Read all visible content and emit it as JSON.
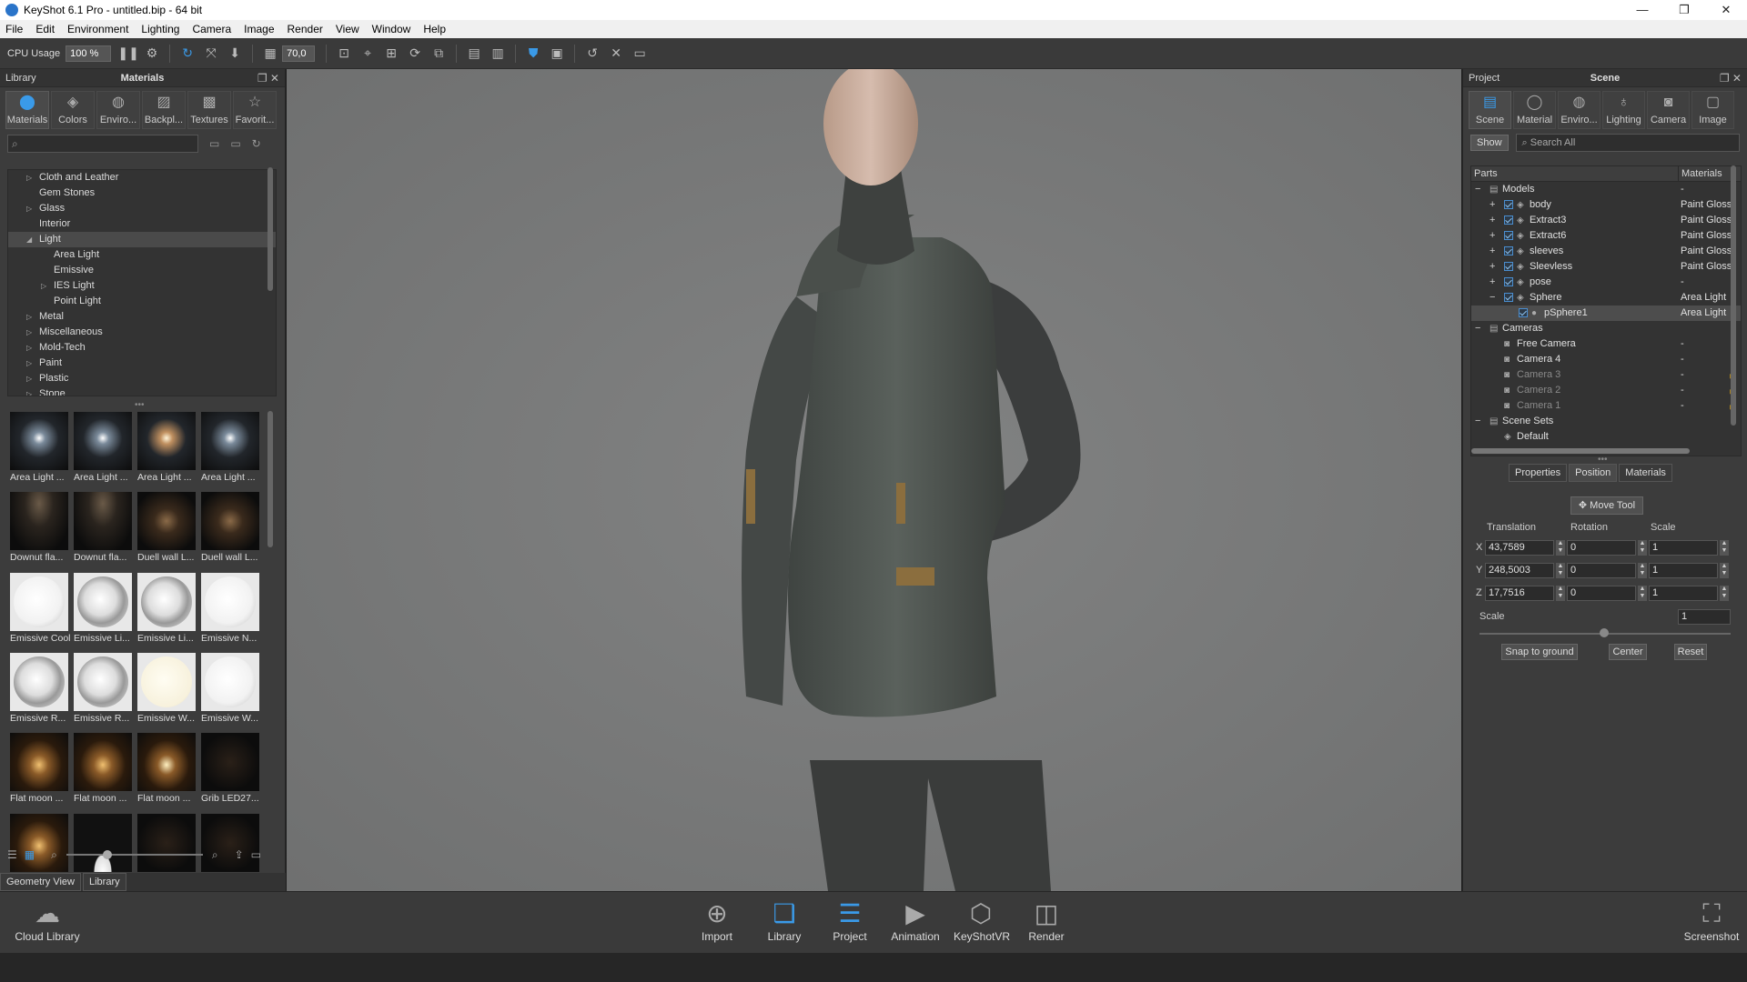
{
  "window": {
    "title": "KeyShot 6.1 Pro  - untitled.bip  - 64 bit",
    "controls": [
      "—",
      "❐",
      "✕"
    ]
  },
  "menu": [
    "File",
    "Edit",
    "Environment",
    "Lighting",
    "Camera",
    "Image",
    "Render",
    "View",
    "Window",
    "Help"
  ],
  "toolbar": {
    "cpu_label": "CPU Usage",
    "cpu_value": "100 %",
    "fov_value": "70,0"
  },
  "library": {
    "panel_left": "Library",
    "panel_title": "Materials",
    "tabs": [
      "Materials",
      "Colors",
      "Enviro...",
      "Backpl...",
      "Textures",
      "Favorit..."
    ],
    "tree": [
      {
        "label": "Cloth and Leather",
        "arrow": "▷",
        "level": 0
      },
      {
        "label": "Gem Stones",
        "arrow": "",
        "level": 0
      },
      {
        "label": "Glass",
        "arrow": "▷",
        "level": 0
      },
      {
        "label": "Interior",
        "arrow": "",
        "level": 0
      },
      {
        "label": "Light",
        "arrow": "◢",
        "level": 0
      },
      {
        "label": "Area Light",
        "arrow": "",
        "level": 1
      },
      {
        "label": "Emissive",
        "arrow": "",
        "level": 1
      },
      {
        "label": "IES Light",
        "arrow": "▷",
        "level": 1
      },
      {
        "label": "Point Light",
        "arrow": "",
        "level": 1
      },
      {
        "label": "Metal",
        "arrow": "▷",
        "level": 0
      },
      {
        "label": "Miscellaneous",
        "arrow": "▷",
        "level": 0
      },
      {
        "label": "Mold-Tech",
        "arrow": "▷",
        "level": 0
      },
      {
        "label": "Paint",
        "arrow": "▷",
        "level": 0
      },
      {
        "label": "Plastic",
        "arrow": "▷",
        "level": 0
      },
      {
        "label": "Stone",
        "arrow": "▷",
        "level": 0
      }
    ],
    "thumbnails": [
      "Area Light ...",
      "Area Light ...",
      "Area Light ...",
      "Area Light ...",
      "Downut fla...",
      "Downut fla...",
      "Duell wall L...",
      "Duell wall L...",
      "Emissive Cool",
      "Emissive Li...",
      "Emissive Li...",
      "Emissive N...",
      "Emissive R...",
      "Emissive R...",
      "Emissive W...",
      "Emissive W...",
      "Flat moon ...",
      "Flat moon ...",
      "Flat moon ...",
      "Grib LED27...",
      "",
      "",
      "",
      ""
    ],
    "bottom_tabs": [
      "Geometry View",
      "Library"
    ]
  },
  "project": {
    "panel_left": "Project",
    "panel_title": "Scene",
    "tabs": [
      "Scene",
      "Material",
      "Enviro...",
      "Lighting",
      "Camera",
      "Image"
    ],
    "show_button": "Show",
    "search_placeholder": "Search All",
    "columns": [
      "Parts",
      "Materials"
    ],
    "rows": [
      {
        "name": "Models",
        "mat": "-",
        "level": 0,
        "exp": "−",
        "check": false,
        "dim": false
      },
      {
        "name": "body",
        "mat": "Paint Gloss",
        "level": 1,
        "exp": "+",
        "check": true,
        "dim": false
      },
      {
        "name": "Extract3",
        "mat": "Paint Gloss",
        "level": 1,
        "exp": "+",
        "check": true,
        "dim": false
      },
      {
        "name": "Extract6",
        "mat": "Paint Gloss",
        "level": 1,
        "exp": "+",
        "check": true,
        "dim": false
      },
      {
        "name": "sleeves",
        "mat": "Paint Gloss",
        "level": 1,
        "exp": "+",
        "check": true,
        "dim": false
      },
      {
        "name": "Sleevless",
        "mat": "Paint Gloss",
        "level": 1,
        "exp": "+",
        "check": true,
        "dim": false
      },
      {
        "name": "pose",
        "mat": "-",
        "level": 1,
        "exp": "+",
        "check": true,
        "dim": false
      },
      {
        "name": "Sphere",
        "mat": "Area Light",
        "level": 1,
        "exp": "−",
        "check": true,
        "dim": false
      },
      {
        "name": "pSphere1",
        "mat": "Area Light",
        "level": 2,
        "exp": "",
        "check": true,
        "dim": false,
        "sel": true
      },
      {
        "name": "Cameras",
        "mat": "",
        "level": 0,
        "exp": "−",
        "check": false,
        "dim": false
      },
      {
        "name": "Free Camera",
        "mat": "-",
        "level": 1,
        "exp": "",
        "check": false,
        "dim": false
      },
      {
        "name": "Camera 4",
        "mat": "-",
        "level": 1,
        "exp": "",
        "check": false,
        "dim": false
      },
      {
        "name": "Camera 3",
        "mat": "-",
        "level": 1,
        "exp": "",
        "check": false,
        "dim": true,
        "lock": true
      },
      {
        "name": "Camera 2",
        "mat": "-",
        "level": 1,
        "exp": "",
        "check": false,
        "dim": true,
        "lock": true
      },
      {
        "name": "Camera 1",
        "mat": "-",
        "level": 1,
        "exp": "",
        "check": false,
        "dim": true,
        "lock": true
      },
      {
        "name": "Scene Sets",
        "mat": "",
        "level": 0,
        "exp": "−",
        "check": false,
        "dim": false
      },
      {
        "name": "Default",
        "mat": "",
        "level": 1,
        "exp": "",
        "check": false,
        "dim": false
      }
    ],
    "prop_tabs": [
      "Properties",
      "Position",
      "Materials"
    ],
    "move_tool": "Move Tool",
    "headers": {
      "translation": "Translation",
      "rotation": "Rotation",
      "scale": "Scale"
    },
    "axes": [
      "X",
      "Y",
      "Z"
    ],
    "translation": [
      "43,7589",
      "248,5003",
      "17,7516"
    ],
    "rotation": [
      "0",
      "0",
      "0"
    ],
    "scale": [
      "1",
      "1",
      "1"
    ],
    "uniform_scale_label": "Scale",
    "uniform_scale_value": "1",
    "buttons": [
      "Snap to ground",
      "Center",
      "Reset"
    ]
  },
  "dock": {
    "cloud_library": "Cloud Library",
    "items": [
      "Import",
      "Library",
      "Project",
      "Animation",
      "KeyShotVR",
      "Render"
    ],
    "screenshot": "Screenshot"
  }
}
